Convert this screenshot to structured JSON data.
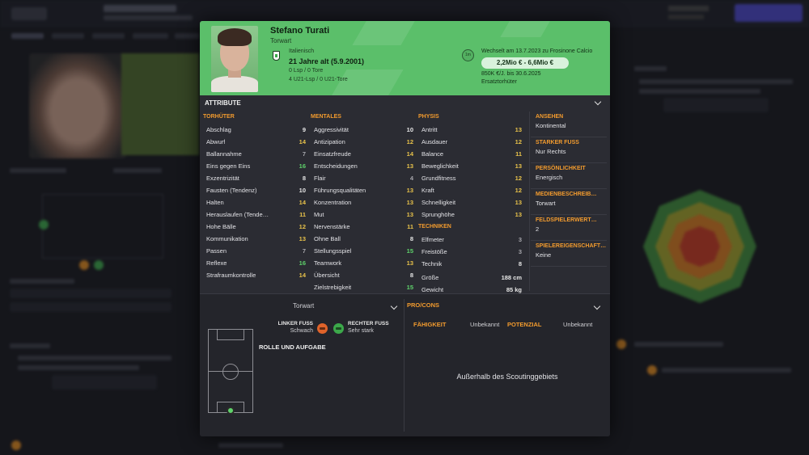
{
  "player": {
    "name": "Stefano Turati",
    "position": "Torwart",
    "nationality": "Italienisch",
    "age": "21 Jahre alt (5.9.2001)",
    "caps_line1": "0 Lsp / 0 Tore",
    "caps_line2": "4 U21-Lsp / 0 U21-Tore"
  },
  "transfer": {
    "clock": "1m",
    "info": "Wechselt am 13.7.2023 zu Frosinone Calcio",
    "value": "2,2Mio € - 6,6Mio €",
    "wage": "850K €/J. bis 30.6.2025",
    "status": "Ersatztorhüter"
  },
  "attributes": {
    "title": "ATTRIBUTE",
    "torhueter": {
      "heading": "TORHÜTER",
      "items": [
        {
          "label": "Abschlag",
          "value": "9",
          "tone": "white"
        },
        {
          "label": "Abwurf",
          "value": "14",
          "tone": "yellow"
        },
        {
          "label": "Ballannahme",
          "value": "7",
          "tone": "grey"
        },
        {
          "label": "Eins gegen Eins",
          "value": "16",
          "tone": "green"
        },
        {
          "label": "Exzentrizität",
          "value": "8",
          "tone": "white"
        },
        {
          "label": "Fausten (Tendenz)",
          "value": "10",
          "tone": "white"
        },
        {
          "label": "Halten",
          "value": "14",
          "tone": "yellow"
        },
        {
          "label": "Herauslaufen (Tende…",
          "value": "11",
          "tone": "yellow"
        },
        {
          "label": "Hohe Bälle",
          "value": "12",
          "tone": "yellow"
        },
        {
          "label": "Kommunikation",
          "value": "13",
          "tone": "yellow"
        },
        {
          "label": "Passen",
          "value": "7",
          "tone": "grey"
        },
        {
          "label": "Reflexe",
          "value": "16",
          "tone": "green"
        },
        {
          "label": "Strafraumkontrolle",
          "value": "14",
          "tone": "yellow"
        }
      ]
    },
    "mentale": {
      "heading": "MENTALES",
      "items": [
        {
          "label": "Aggressivität",
          "value": "10",
          "tone": "white"
        },
        {
          "label": "Antizipation",
          "value": "12",
          "tone": "yellow"
        },
        {
          "label": "Einsatzfreude",
          "value": "14",
          "tone": "yellow"
        },
        {
          "label": "Entscheidungen",
          "value": "13",
          "tone": "yellow"
        },
        {
          "label": "Flair",
          "value": "4",
          "tone": "grey"
        },
        {
          "label": "Führungsqualitäten",
          "value": "13",
          "tone": "yellow"
        },
        {
          "label": "Konzentration",
          "value": "13",
          "tone": "yellow"
        },
        {
          "label": "Mut",
          "value": "13",
          "tone": "yellow"
        },
        {
          "label": "Nervenstärke",
          "value": "11",
          "tone": "yellow"
        },
        {
          "label": "Ohne Ball",
          "value": "8",
          "tone": "white"
        },
        {
          "label": "Stellungsspiel",
          "value": "15",
          "tone": "green"
        },
        {
          "label": "Teamwork",
          "value": "13",
          "tone": "yellow"
        },
        {
          "label": "Übersicht",
          "value": "8",
          "tone": "white"
        },
        {
          "label": "Zielstrebigkeit",
          "value": "15",
          "tone": "green"
        }
      ]
    },
    "physis": {
      "heading": "PHYSIS",
      "items": [
        {
          "label": "Antritt",
          "value": "13",
          "tone": "yellow"
        },
        {
          "label": "Ausdauer",
          "value": "12",
          "tone": "yellow"
        },
        {
          "label": "Balance",
          "value": "11",
          "tone": "yellow"
        },
        {
          "label": "Beweglichkeit",
          "value": "13",
          "tone": "yellow"
        },
        {
          "label": "Grundfitness",
          "value": "12",
          "tone": "yellow"
        },
        {
          "label": "Kraft",
          "value": "12",
          "tone": "yellow"
        },
        {
          "label": "Schnelligkeit",
          "value": "13",
          "tone": "yellow"
        },
        {
          "label": "Sprunghöhe",
          "value": "13",
          "tone": "yellow"
        }
      ]
    },
    "techniken": {
      "heading": "TECHNIKEN",
      "items": [
        {
          "label": "Elfmeter",
          "value": "3",
          "tone": "grey"
        },
        {
          "label": "Freistöße",
          "value": "3",
          "tone": "grey"
        },
        {
          "label": "Technik",
          "value": "8",
          "tone": "white"
        }
      ]
    },
    "body": [
      {
        "label": "Größe",
        "value": "188 cm"
      },
      {
        "label": "Gewicht",
        "value": "85 kg"
      }
    ]
  },
  "side": [
    {
      "heading": "ANSEHEN",
      "value": "Kontinental"
    },
    {
      "heading": "STARKER FUSS",
      "value": "Nur Rechts"
    },
    {
      "heading": "PERSÖNLICHKEIT",
      "value": "Energisch"
    },
    {
      "heading": "MEDIENBESCHREIB…",
      "value": "Torwart"
    },
    {
      "heading": "FELDSPIELERWERT…",
      "value": "2"
    },
    {
      "heading": "SPIELEREIGENSCHAFT…",
      "value": "Keine"
    }
  ],
  "bottom": {
    "position": "Torwart",
    "left_foot_label": "LINKER FUSS",
    "left_foot_value": "Schwach",
    "right_foot_label": "RECHTER FUSS",
    "right_foot_value": "Sehr stark",
    "roles_title": "ROLLE UND AUFGABE",
    "procons_title": "PRO/CONS",
    "ability_label": "FÄHIGKEIT",
    "ability_value": "Unbekannt",
    "potential_label": "POTENZIAL",
    "potential_value": "Unbekannt",
    "scouting_message": "Außerhalb des Scoutinggebiets"
  },
  "colors": {
    "header_green": "#5bbf6a",
    "section_orange": "#f29b2e",
    "value_green": "#5fd36b",
    "value_yellow": "#e8c24a",
    "left_foot": "#e0632a",
    "right_foot": "#3ca84a"
  }
}
